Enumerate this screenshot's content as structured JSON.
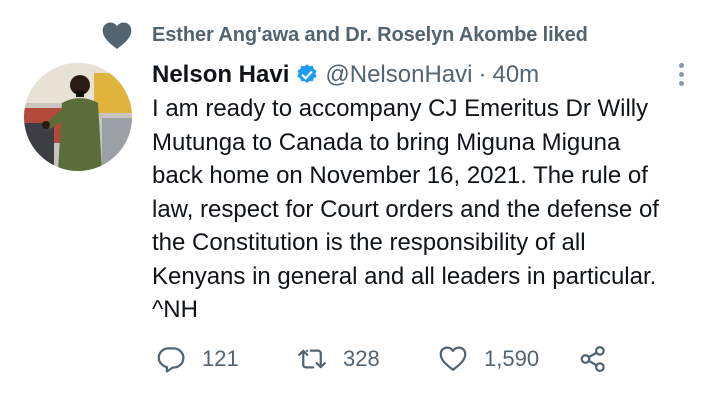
{
  "social_context": {
    "text": "Esther Ang'awa and Dr. Roselyn Akombe liked",
    "icon": "heart-icon"
  },
  "tweet": {
    "author_name": "Nelson Havi",
    "verified": true,
    "handle": "@NelsonHavi",
    "separator": "·",
    "time": "40m",
    "text_lines": [
      "I am ready to accompany CJ Emeritus Dr Willy",
      "Mutunga to Canada to bring Miguna Miguna",
      "back home on November 16, 2021. The rule of",
      "law, respect for Court orders and the defense of",
      "the Constitution is the responsibility of all",
      "Kenyans in general and all leaders in particular.",
      "^NH"
    ]
  },
  "actions": {
    "reply_count": "121",
    "retweet_count": "328",
    "like_count": "1,590"
  },
  "colors": {
    "text_primary": "#0f1419",
    "text_secondary": "#536471",
    "verified_blue": "#1d9bf0",
    "icon_gray": "#536471"
  }
}
